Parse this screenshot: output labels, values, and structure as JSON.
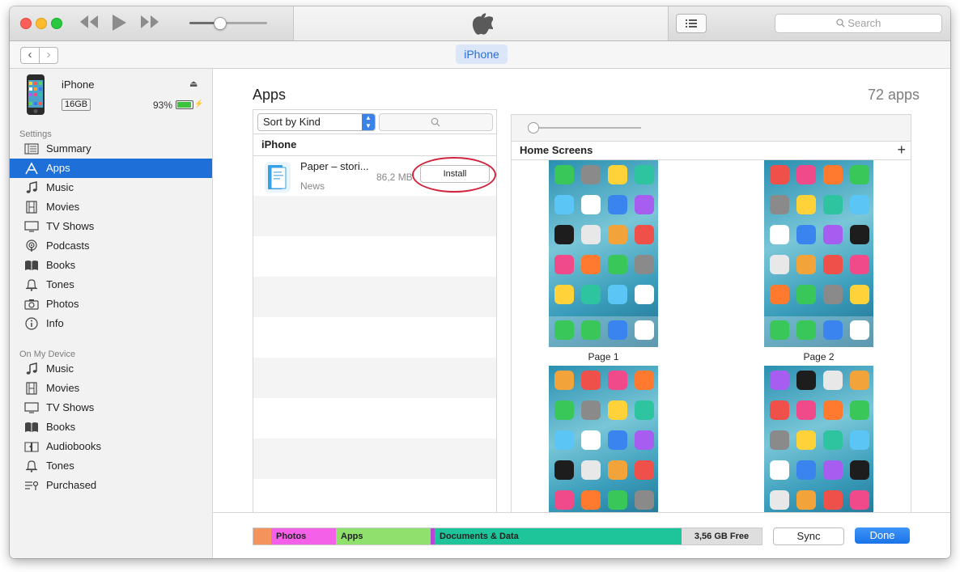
{
  "toolbar": {
    "search_placeholder": "Search"
  },
  "navbar": {
    "device_tab": "iPhone"
  },
  "sidebar": {
    "device": {
      "name": "iPhone",
      "capacity": "16GB",
      "battery": "93%",
      "battery_level": 0.93
    },
    "settings_header": "Settings",
    "settings_items": [
      {
        "label": "Summary",
        "icon": "summary-icon"
      },
      {
        "label": "Apps",
        "icon": "apps-icon",
        "selected": true
      },
      {
        "label": "Music",
        "icon": "music-note-icon"
      },
      {
        "label": "Movies",
        "icon": "film-icon"
      },
      {
        "label": "TV Shows",
        "icon": "tv-icon"
      },
      {
        "label": "Podcasts",
        "icon": "podcast-icon"
      },
      {
        "label": "Books",
        "icon": "book-icon"
      },
      {
        "label": "Tones",
        "icon": "bell-icon"
      },
      {
        "label": "Photos",
        "icon": "camera-icon"
      },
      {
        "label": "Info",
        "icon": "info-icon"
      }
    ],
    "device_header": "On My Device",
    "device_items": [
      {
        "label": "Music",
        "icon": "music-note-icon"
      },
      {
        "label": "Movies",
        "icon": "film-icon"
      },
      {
        "label": "TV Shows",
        "icon": "tv-icon"
      },
      {
        "label": "Books",
        "icon": "book-icon"
      },
      {
        "label": "Audiobooks",
        "icon": "audiobook-icon"
      },
      {
        "label": "Tones",
        "icon": "bell-icon"
      },
      {
        "label": "Purchased",
        "icon": "purchased-icon"
      }
    ]
  },
  "main": {
    "title": "Apps",
    "count": "72 apps",
    "sort_label": "Sort by Kind",
    "group_header": "iPhone",
    "app": {
      "name": "Paper – stori...",
      "category": "News",
      "size": "86,2 MB",
      "install_label": "Install"
    },
    "home_screens_header": "Home Screens",
    "pages": [
      "Page 1",
      "Page 2"
    ]
  },
  "storage": {
    "segments": [
      {
        "label": "",
        "color": "#f5935c"
      },
      {
        "label": "Photos",
        "color": "#f460e8"
      },
      {
        "label": "Apps",
        "color": "#8fe06c"
      },
      {
        "label": "",
        "color": "#b548d6"
      },
      {
        "label": "Documents & Data",
        "color": "#1ec49a"
      },
      {
        "label": "3,56 GB Free",
        "color": "#dedede"
      }
    ],
    "sync_label": "Sync",
    "done_label": "Done"
  },
  "colors": {
    "accent": "#1f6fd8",
    "annotation": "#d0253c"
  }
}
